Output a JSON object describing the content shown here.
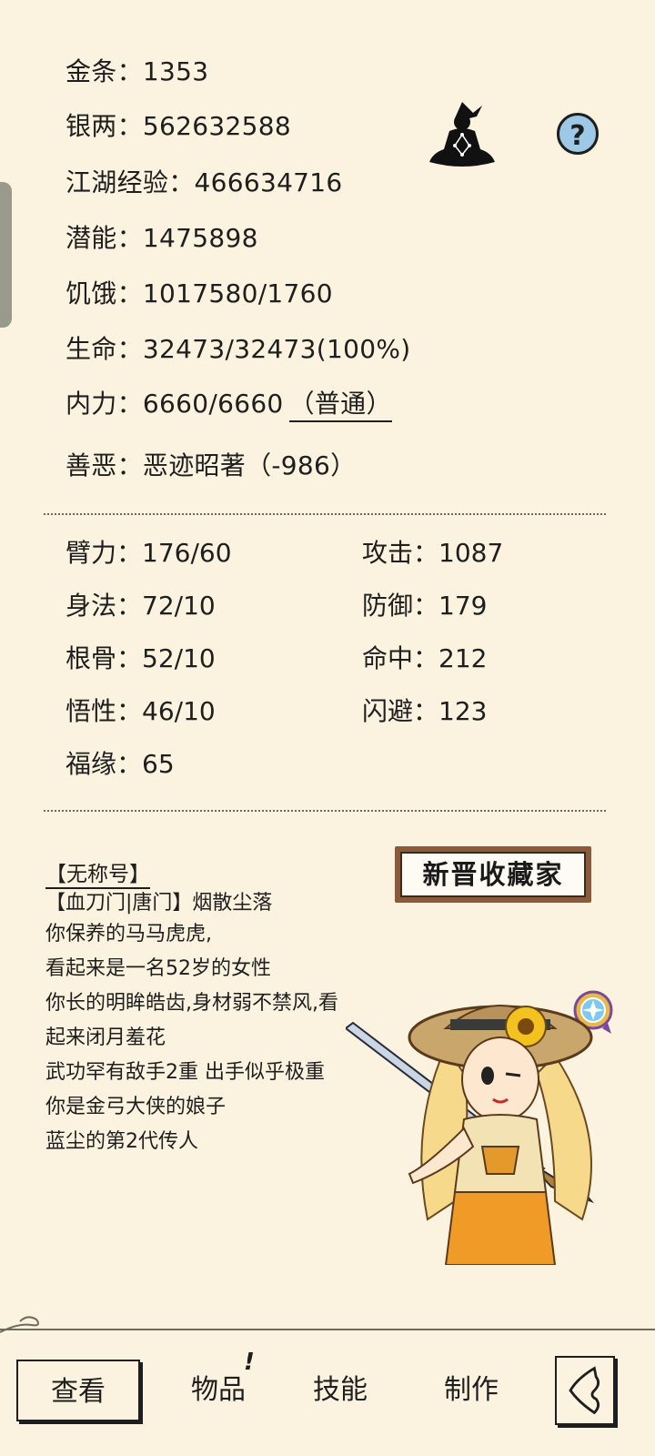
{
  "stats": {
    "gold": "金条：1353",
    "silver": "银两：562632588",
    "exp": "江湖经验：466634716",
    "potential": "潜能：1475898",
    "hunger": "饥饿：1017580/1760",
    "life": "生命：32473/32473(100%)",
    "inner_power": "内力：6660/6660",
    "inner_power_mode": "（普通）",
    "morality": "善恶：恶迹昭著（-986）"
  },
  "attributes": {
    "strength": "臂力：176/60",
    "agility": "身法：72/10",
    "constitution": "根骨：52/10",
    "comprehension": "悟性：46/10",
    "luck": "福缘：65",
    "attack": "攻击：1087",
    "defense": "防御：179",
    "hit": "命中：212",
    "dodge": "闪避：123"
  },
  "plaque": "新晋收藏家",
  "help_icon_text": "?",
  "bio": {
    "title": "【无称号】",
    "lines": [
      "【血刀门|唐门】烟散尘落",
      "你保养的马马虎虎,",
      "看起来是一名52岁的女性",
      "你长的明眸皓齿,身材弱不禁风,看",
      "起来闭月羞花",
      "武功罕有敌手2重 出手似乎极重",
      "你是金弓大侠的娘子",
      "蓝尘的第2代传人"
    ]
  },
  "nav": {
    "view": "查看",
    "items": "物品",
    "items_alert": "!",
    "skills": "技能",
    "craft": "制作"
  },
  "icons": {
    "help": "help-icon",
    "meditation": "meditation-icon",
    "badge": "badge-icon",
    "back": "back-icon"
  }
}
